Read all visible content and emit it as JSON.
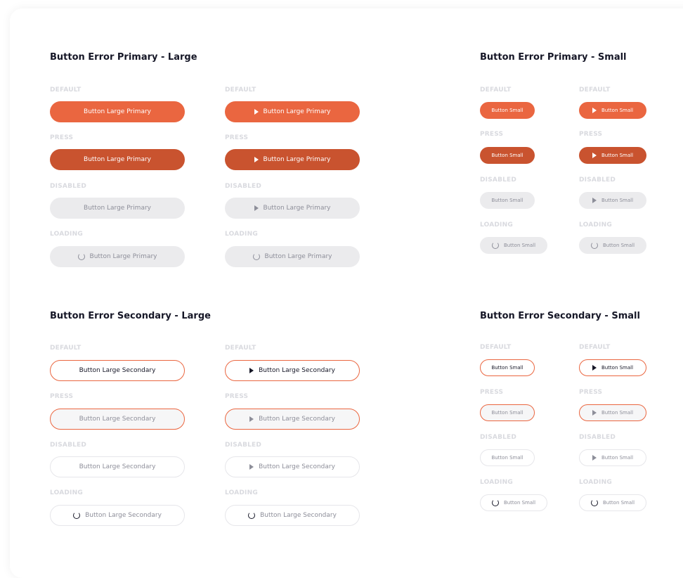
{
  "states": {
    "default": "DEFAULT",
    "press": "PRESS",
    "disabled": "DISABLED",
    "loading": "LOADING"
  },
  "sections": {
    "primary_large": {
      "title": "Button Error Primary - Large",
      "label": "Button Large Primary"
    },
    "primary_small": {
      "title": "Button Error Primary - Small",
      "label": "Button Small"
    },
    "secondary_large": {
      "title": "Button Error Secondary - Large",
      "label": "Button Large Secondary"
    },
    "secondary_small": {
      "title": "Button Error Secondary - Small",
      "label": "Button Small"
    }
  },
  "colors": {
    "error": "#ea6640",
    "error_press": "#c9532f",
    "disabled_bg": "#ebebed",
    "text_dark": "#161727",
    "state_label": "#d9dadf"
  },
  "icons": {
    "leading": "play-icon",
    "loading": "spinner-icon"
  }
}
